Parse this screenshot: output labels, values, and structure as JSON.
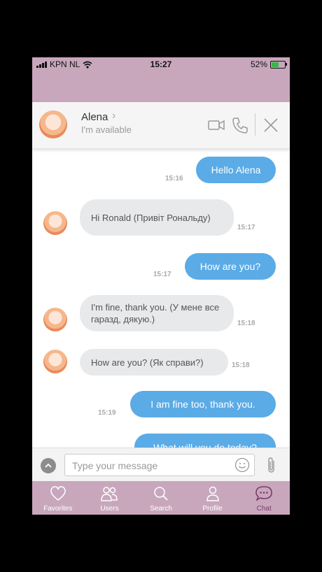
{
  "status": {
    "carrier": "KPN NL",
    "time": "15:27",
    "battery": "52%"
  },
  "header": {
    "name": "Alena",
    "subtitle": "I'm available"
  },
  "messages": [
    {
      "dir": "out",
      "text": "Hello Alena",
      "time": "15:16"
    },
    {
      "dir": "in",
      "text": "Hi Ronald (Привіт Рональду)",
      "time": "15:17"
    },
    {
      "dir": "out",
      "text": "How are you?",
      "time": "15:17"
    },
    {
      "dir": "in",
      "text": "I'm fine, thank you. (У мене все гаразд, дякую.)",
      "time": "15:18"
    },
    {
      "dir": "in",
      "text": "How are you? (Як справи?)",
      "time": "15:18"
    },
    {
      "dir": "out",
      "text": "I am fine too, thank you.",
      "time": "15:19"
    },
    {
      "dir": "out",
      "text": "What will you do today?",
      "time": ""
    }
  ],
  "input": {
    "placeholder": "Type your message"
  },
  "tabs": [
    {
      "label": "Favorites",
      "icon": "heart-icon"
    },
    {
      "label": "Users",
      "icon": "users-icon"
    },
    {
      "label": "Search",
      "icon": "search-icon"
    },
    {
      "label": "Profile",
      "icon": "profile-icon"
    },
    {
      "label": "Chat",
      "icon": "chat-icon",
      "active": true
    }
  ],
  "colors": {
    "accent": "#c8a7bd",
    "outgoing": "#5aabe6",
    "incoming": "#e8e9eb",
    "active_tab": "#7a3d6a"
  }
}
